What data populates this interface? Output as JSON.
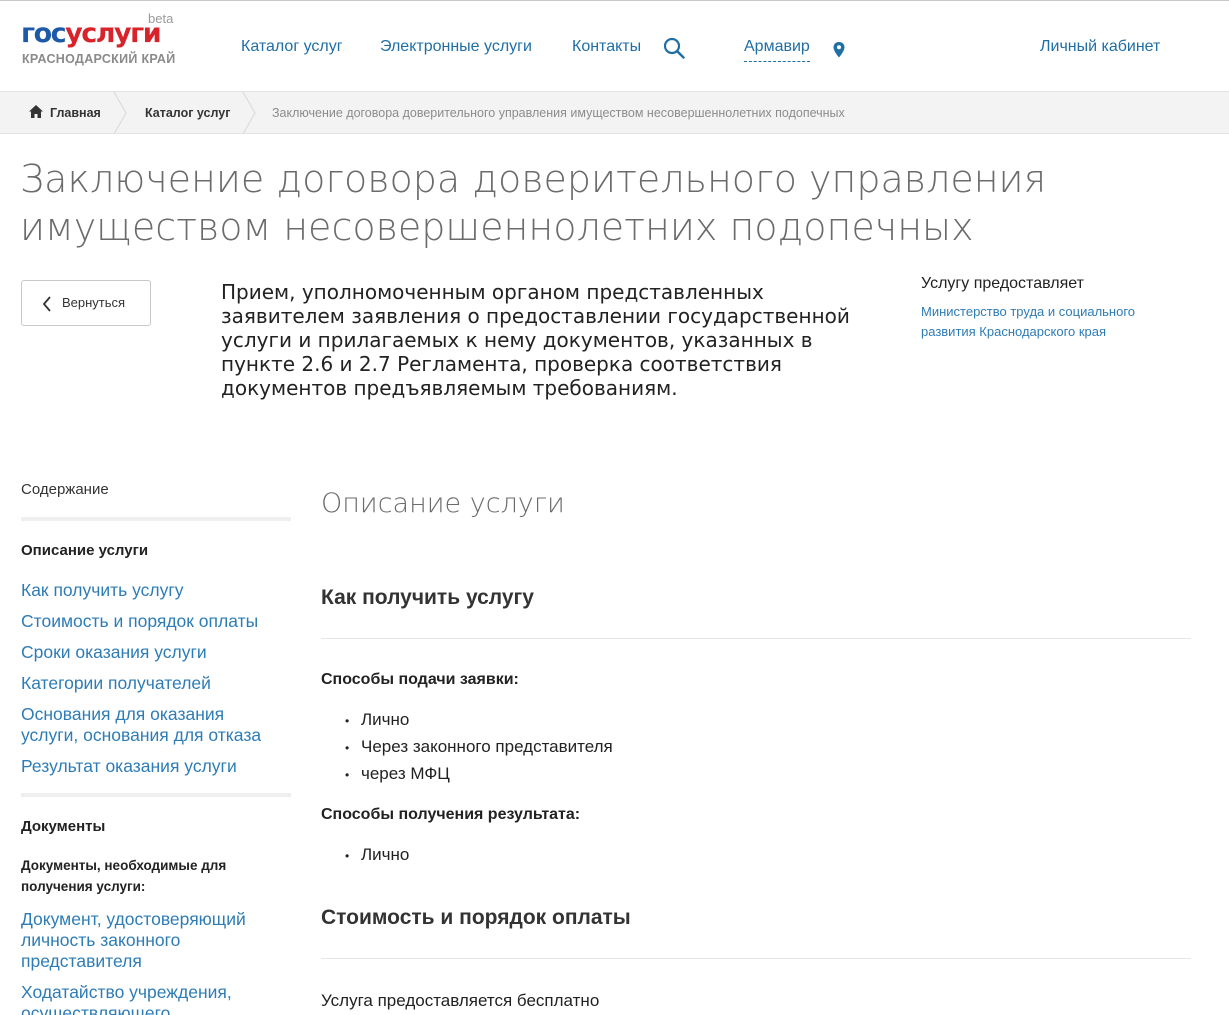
{
  "header": {
    "logo_part1": "гос",
    "logo_part2": "услуги",
    "logo_beta": "beta",
    "logo_region": "КРАСНОДАРСКИЙ КРАЙ",
    "nav": [
      "Каталог услуг",
      "Электронные услуги",
      "Контакты"
    ],
    "city": "Армавир",
    "cabinet": "Личный кабинет"
  },
  "breadcrumb": {
    "home": "Главная",
    "catalog": "Каталог услуг",
    "current": "Заключение договора доверительного управления имуществом несовершеннолетних подопечных"
  },
  "page": {
    "title": "Заключение договора доверительного управления имуществом несовершеннолетних подопечных",
    "back_label": "Вернуться",
    "lead": "Прием, уполномоченным органом представленных заявителем заявления о предоставлении государственной услуги и прилагаемых к нему документов, указанных в пункте 2.6 и 2.7 Регламента, проверка соответствия документов предъявляемым требованиям.",
    "provider_title": "Услугу предоставляет",
    "provider_link": "Министерство труда и социального развития Краснодарского края"
  },
  "sidebar": {
    "heading": "Содержание",
    "section1": "Описание услуги",
    "links1": [
      "Как получить услугу",
      "Стоимость и порядок оплаты",
      "Сроки оказания услуги",
      "Категории получателей",
      "Основания для оказания услуги, основания для отказа",
      "Результат оказания услуги"
    ],
    "section2": "Документы",
    "sub2": "Документы, необходимые для получения услуги:",
    "links2": [
      "Документ, удостоверяющий личность законного представителя",
      "Ходатайство учреждения, осуществляющего"
    ]
  },
  "main": {
    "h1": "Описание услуги",
    "how_title": "Как получить услугу",
    "submit_label": "Способы подачи заявки:",
    "submit_items": [
      "Лично",
      "Через законного представителя",
      "через МФЦ"
    ],
    "result_label": "Способы получения результата:",
    "result_items": [
      "Лично"
    ],
    "cost_title": "Стоимость и порядок оплаты",
    "cost_text": "Услуга предоставляется бесплатно"
  },
  "colors": {
    "link": "#1f6ea6",
    "logo_blue": "#1c5aa8",
    "logo_red": "#d8232a"
  },
  "icons": [
    "search-icon",
    "location-pin-icon",
    "home-icon",
    "chevron-left-icon"
  ]
}
